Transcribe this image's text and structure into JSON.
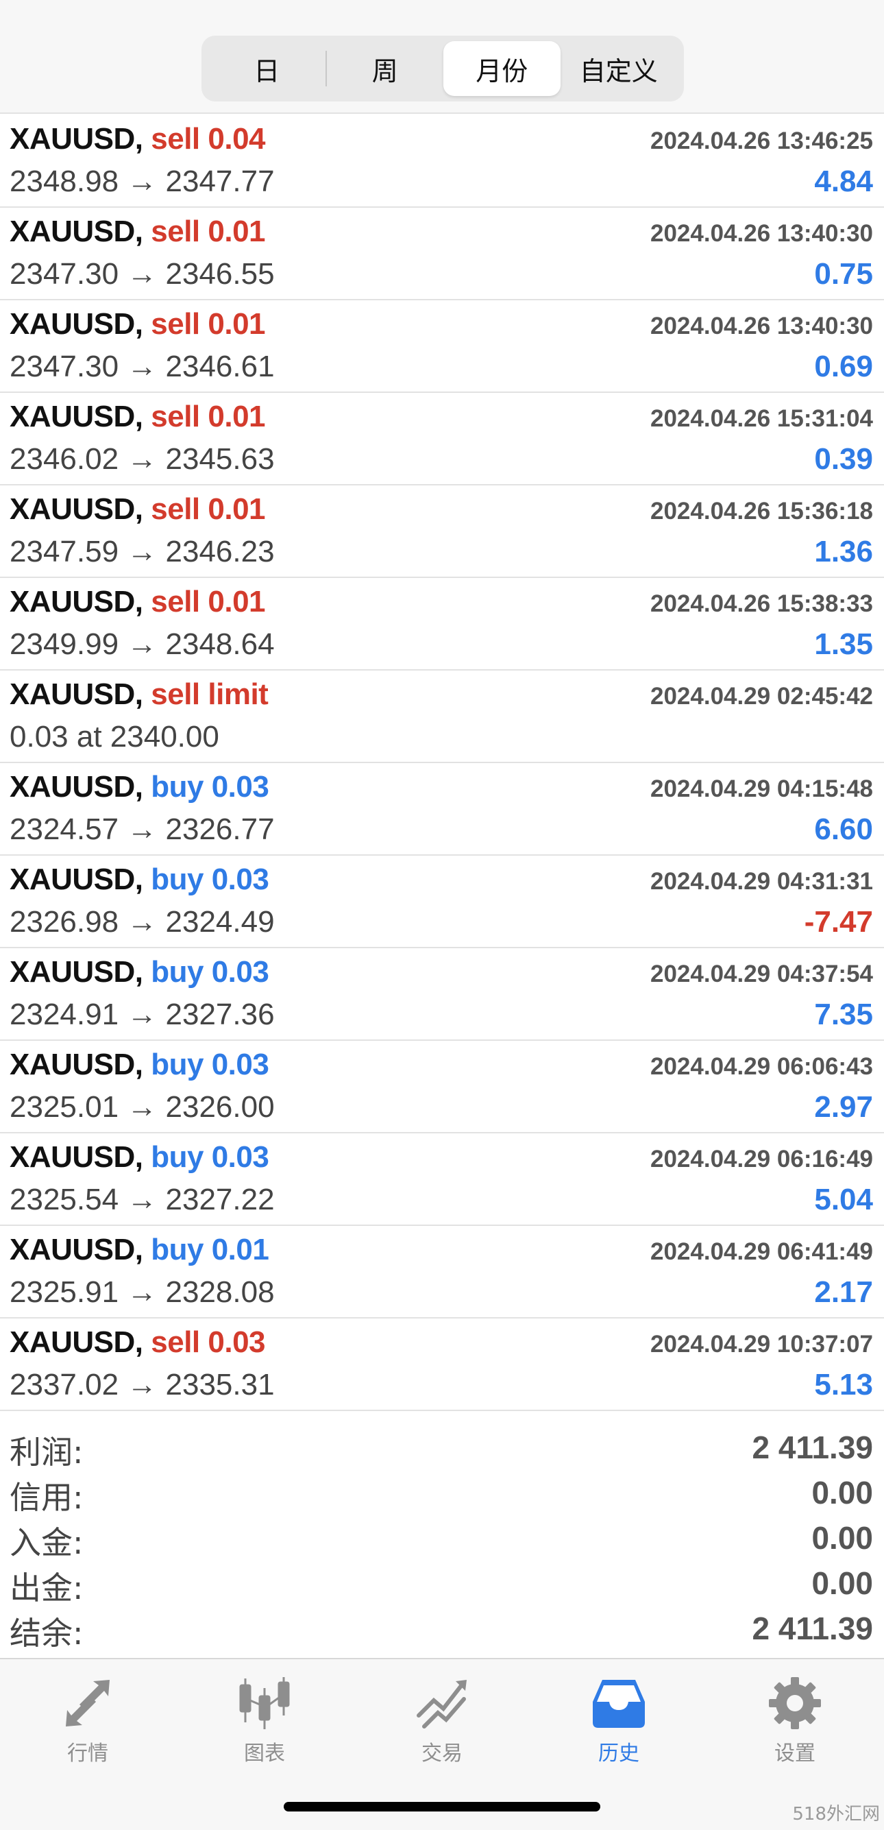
{
  "segmented": {
    "tabs": [
      {
        "label": "日",
        "active": false
      },
      {
        "label": "周",
        "active": false
      },
      {
        "label": "月份",
        "active": true
      },
      {
        "label": "自定义",
        "active": false
      }
    ]
  },
  "colors": {
    "sell": "#d33b2c",
    "buy": "#2f7be5",
    "positive": "#2f7be5",
    "negative": "#d33b2c"
  },
  "trades": [
    {
      "symbol": "XAUUSD,",
      "action": "sell 0.04",
      "side": "sell",
      "time": "2024.04.26 13:46:25",
      "prices": "2348.98 → 2347.77",
      "profit": "4.84"
    },
    {
      "symbol": "XAUUSD,",
      "action": "sell 0.01",
      "side": "sell",
      "time": "2024.04.26 13:40:30",
      "prices": "2347.30 → 2346.55",
      "profit": "0.75"
    },
    {
      "symbol": "XAUUSD,",
      "action": "sell 0.01",
      "side": "sell",
      "time": "2024.04.26 13:40:30",
      "prices": "2347.30 → 2346.61",
      "profit": "0.69"
    },
    {
      "symbol": "XAUUSD,",
      "action": "sell 0.01",
      "side": "sell",
      "time": "2024.04.26 15:31:04",
      "prices": "2346.02 → 2345.63",
      "profit": "0.39"
    },
    {
      "symbol": "XAUUSD,",
      "action": "sell 0.01",
      "side": "sell",
      "time": "2024.04.26 15:36:18",
      "prices": "2347.59 → 2346.23",
      "profit": "1.36"
    },
    {
      "symbol": "XAUUSD,",
      "action": "sell 0.01",
      "side": "sell",
      "time": "2024.04.26 15:38:33",
      "prices": "2349.99 → 2348.64",
      "profit": "1.35"
    },
    {
      "symbol": "XAUUSD,",
      "action": "sell limit",
      "side": "sell",
      "time": "2024.04.29 02:45:42",
      "prices": "0.03 at 2340.00",
      "profit": ""
    },
    {
      "symbol": "XAUUSD,",
      "action": "buy 0.03",
      "side": "buy",
      "time": "2024.04.29 04:15:48",
      "prices": "2324.57 → 2326.77",
      "profit": "6.60"
    },
    {
      "symbol": "XAUUSD,",
      "action": "buy 0.03",
      "side": "buy",
      "time": "2024.04.29 04:31:31",
      "prices": "2326.98 → 2324.49",
      "profit": "-7.47"
    },
    {
      "symbol": "XAUUSD,",
      "action": "buy 0.03",
      "side": "buy",
      "time": "2024.04.29 04:37:54",
      "prices": "2324.91 → 2327.36",
      "profit": "7.35"
    },
    {
      "symbol": "XAUUSD,",
      "action": "buy 0.03",
      "side": "buy",
      "time": "2024.04.29 06:06:43",
      "prices": "2325.01 → 2326.00",
      "profit": "2.97"
    },
    {
      "symbol": "XAUUSD,",
      "action": "buy 0.03",
      "side": "buy",
      "time": "2024.04.29 06:16:49",
      "prices": "2325.54 → 2327.22",
      "profit": "5.04"
    },
    {
      "symbol": "XAUUSD,",
      "action": "buy 0.01",
      "side": "buy",
      "time": "2024.04.29 06:41:49",
      "prices": "2325.91 → 2328.08",
      "profit": "2.17"
    },
    {
      "symbol": "XAUUSD,",
      "action": "sell 0.03",
      "side": "sell",
      "time": "2024.04.29 10:37:07",
      "prices": "2337.02 → 2335.31",
      "profit": "5.13"
    }
  ],
  "summary": [
    {
      "label": "利润:",
      "value": "2 411.39"
    },
    {
      "label": "信用:",
      "value": "0.00"
    },
    {
      "label": "入金:",
      "value": "0.00"
    },
    {
      "label": "出金:",
      "value": "0.00"
    },
    {
      "label": "结余:",
      "value": "2 411.39"
    }
  ],
  "tabbar": {
    "tabs": [
      {
        "label": "行情",
        "icon": "quotes-arrows-icon",
        "active": false
      },
      {
        "label": "图表",
        "icon": "candlestick-chart-icon",
        "active": false
      },
      {
        "label": "交易",
        "icon": "trade-chart-icon",
        "active": false
      },
      {
        "label": "历史",
        "icon": "history-inbox-icon",
        "active": true
      },
      {
        "label": "设置",
        "icon": "gear-icon",
        "active": false
      }
    ]
  },
  "watermark": "518外汇网"
}
